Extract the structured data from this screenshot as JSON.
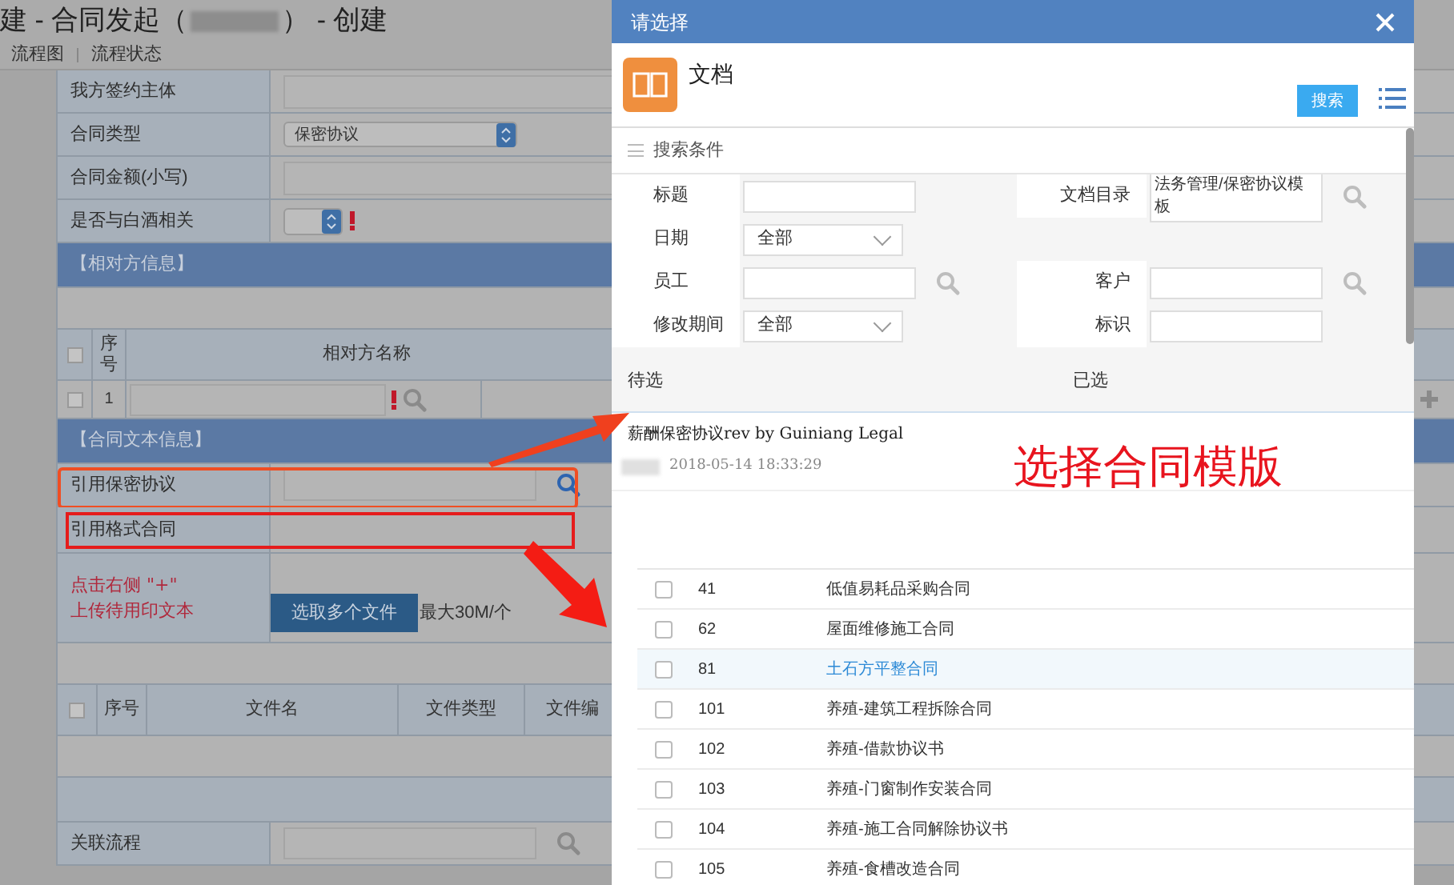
{
  "page": {
    "title_prefix": "建 - 合同发起（",
    "title_suffix": "） - 创建",
    "tabs": [
      {
        "label": "流程图"
      },
      {
        "label": "流程状态"
      }
    ]
  },
  "form": {
    "rows": [
      {
        "kind": "field",
        "label": "我方签约主体"
      },
      {
        "kind": "select",
        "label": "合同类型",
        "value": "保密协议"
      },
      {
        "kind": "field",
        "label": "合同金额(小写)"
      },
      {
        "kind": "toggle",
        "label": "是否与白酒相关",
        "required": true
      },
      {
        "kind": "section",
        "label": "【相对方信息】"
      },
      {
        "kind": "blank"
      },
      {
        "kind": "party_header",
        "checked": false,
        "columns": [
          "序号",
          "相对方名称"
        ]
      },
      {
        "kind": "party_row",
        "checked": false,
        "number": "1",
        "required": true
      },
      {
        "kind": "section",
        "label": "【合同文本信息】"
      },
      {
        "kind": "lookup",
        "label": "引用保密协议",
        "frame": {
          "kind": "rounded"
        }
      },
      {
        "kind": "plain",
        "label": "引用格式合同",
        "frame": {
          "kind": "square"
        }
      },
      {
        "kind": "upload",
        "note": "点击右侧 \"+\"\n上传待用印文本",
        "button": "选取多个文件",
        "limit": "最大30M/个"
      },
      {
        "kind": "blank"
      },
      {
        "kind": "file_header",
        "checked": false,
        "columns": [
          "序号",
          "文件名",
          "文件类型",
          "文件编"
        ]
      },
      {
        "kind": "blank"
      },
      {
        "kind": "band"
      },
      {
        "kind": "lookup",
        "label": "关联流程"
      }
    ]
  },
  "dialog": {
    "title": "请选择",
    "heading": "文档",
    "search_button": "搜索",
    "criteria_title": "搜索条件",
    "criteria": [
      {
        "left": {
          "label": "标题",
          "kind": "text"
        },
        "right": {
          "label": "文档目录",
          "kind": "lookup",
          "value": "法务管理/保密协议模板"
        }
      },
      {
        "left": {
          "label": "日期",
          "kind": "select",
          "value": "全部"
        }
      },
      {
        "left": {
          "label": "员工",
          "kind": "lookup"
        },
        "right": {
          "label": "客户",
          "kind": "lookup"
        }
      },
      {
        "left": {
          "label": "修改期间",
          "kind": "select",
          "value": "全部"
        },
        "right": {
          "label": "标识",
          "kind": "text"
        }
      }
    ],
    "pending_label": "待选",
    "selected_label": "已选",
    "result": {
      "title": "薪酬保密协议rev by Guiniang Legal",
      "date": "2018-05-14 18:33:29"
    },
    "templates": [
      {
        "number": "41",
        "name": "低值易耗品采购合同",
        "highlighted": false
      },
      {
        "number": "62",
        "name": "屋面维修施工合同",
        "highlighted": false
      },
      {
        "number": "81",
        "name": "土石方平整合同",
        "highlighted": true
      },
      {
        "number": "101",
        "name": "养殖-建筑工程拆除合同",
        "highlighted": false
      },
      {
        "number": "102",
        "name": "养殖-借款协议书",
        "highlighted": false
      },
      {
        "number": "103",
        "name": "养殖-门窗制作安装合同",
        "highlighted": false
      },
      {
        "number": "104",
        "name": "养殖-施工合同解除协议书",
        "highlighted": false
      },
      {
        "number": "105",
        "name": "养殖-食槽改造合同",
        "highlighted": false
      }
    ]
  },
  "annotation": {
    "caption": "选择合同模版"
  }
}
